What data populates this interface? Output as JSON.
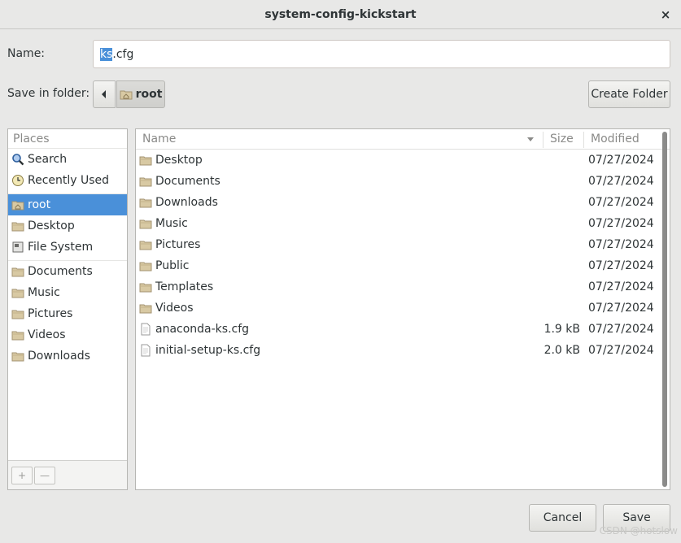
{
  "window": {
    "title": "system-config-kickstart",
    "close_glyph": "×"
  },
  "name_row": {
    "label": "Name:",
    "value_selected": "ks",
    "value_rest": ".cfg"
  },
  "folder_row": {
    "label": "Save in folder:",
    "crumb": "root",
    "create_folder": "Create Folder"
  },
  "places": {
    "header": "Places",
    "group1": [
      {
        "label": "Search",
        "icon": "search-icon"
      },
      {
        "label": "Recently Used",
        "icon": "clock-icon"
      }
    ],
    "group2": [
      {
        "label": "root",
        "icon": "home-folder-icon",
        "active": true
      },
      {
        "label": "Desktop",
        "icon": "folder-icon"
      },
      {
        "label": "File System",
        "icon": "drive-icon"
      }
    ],
    "group3": [
      {
        "label": "Documents",
        "icon": "folder-icon"
      },
      {
        "label": "Music",
        "icon": "folder-icon"
      },
      {
        "label": "Pictures",
        "icon": "folder-icon"
      },
      {
        "label": "Videos",
        "icon": "folder-icon"
      },
      {
        "label": "Downloads",
        "icon": "folder-icon"
      }
    ],
    "add_glyph": "+",
    "remove_glyph": "—"
  },
  "files": {
    "columns": {
      "name": "Name",
      "size": "Size",
      "modified": "Modified"
    },
    "rows": [
      {
        "name": "Desktop",
        "size": "",
        "modified": "07/27/2024",
        "type": "folder"
      },
      {
        "name": "Documents",
        "size": "",
        "modified": "07/27/2024",
        "type": "folder"
      },
      {
        "name": "Downloads",
        "size": "",
        "modified": "07/27/2024",
        "type": "folder"
      },
      {
        "name": "Music",
        "size": "",
        "modified": "07/27/2024",
        "type": "folder"
      },
      {
        "name": "Pictures",
        "size": "",
        "modified": "07/27/2024",
        "type": "folder"
      },
      {
        "name": "Public",
        "size": "",
        "modified": "07/27/2024",
        "type": "folder"
      },
      {
        "name": "Templates",
        "size": "",
        "modified": "07/27/2024",
        "type": "folder"
      },
      {
        "name": "Videos",
        "size": "",
        "modified": "07/27/2024",
        "type": "folder"
      },
      {
        "name": "anaconda-ks.cfg",
        "size": "1.9 kB",
        "modified": "07/27/2024",
        "type": "file"
      },
      {
        "name": "initial-setup-ks.cfg",
        "size": "2.0 kB",
        "modified": "07/27/2024",
        "type": "file"
      }
    ]
  },
  "buttons": {
    "cancel": "Cancel",
    "save": "Save"
  },
  "watermark": "CSDN @hotslow",
  "colors": {
    "accent": "#4a90d9",
    "bg": "#e8e8e7",
    "folder": "#d8c9a3"
  }
}
